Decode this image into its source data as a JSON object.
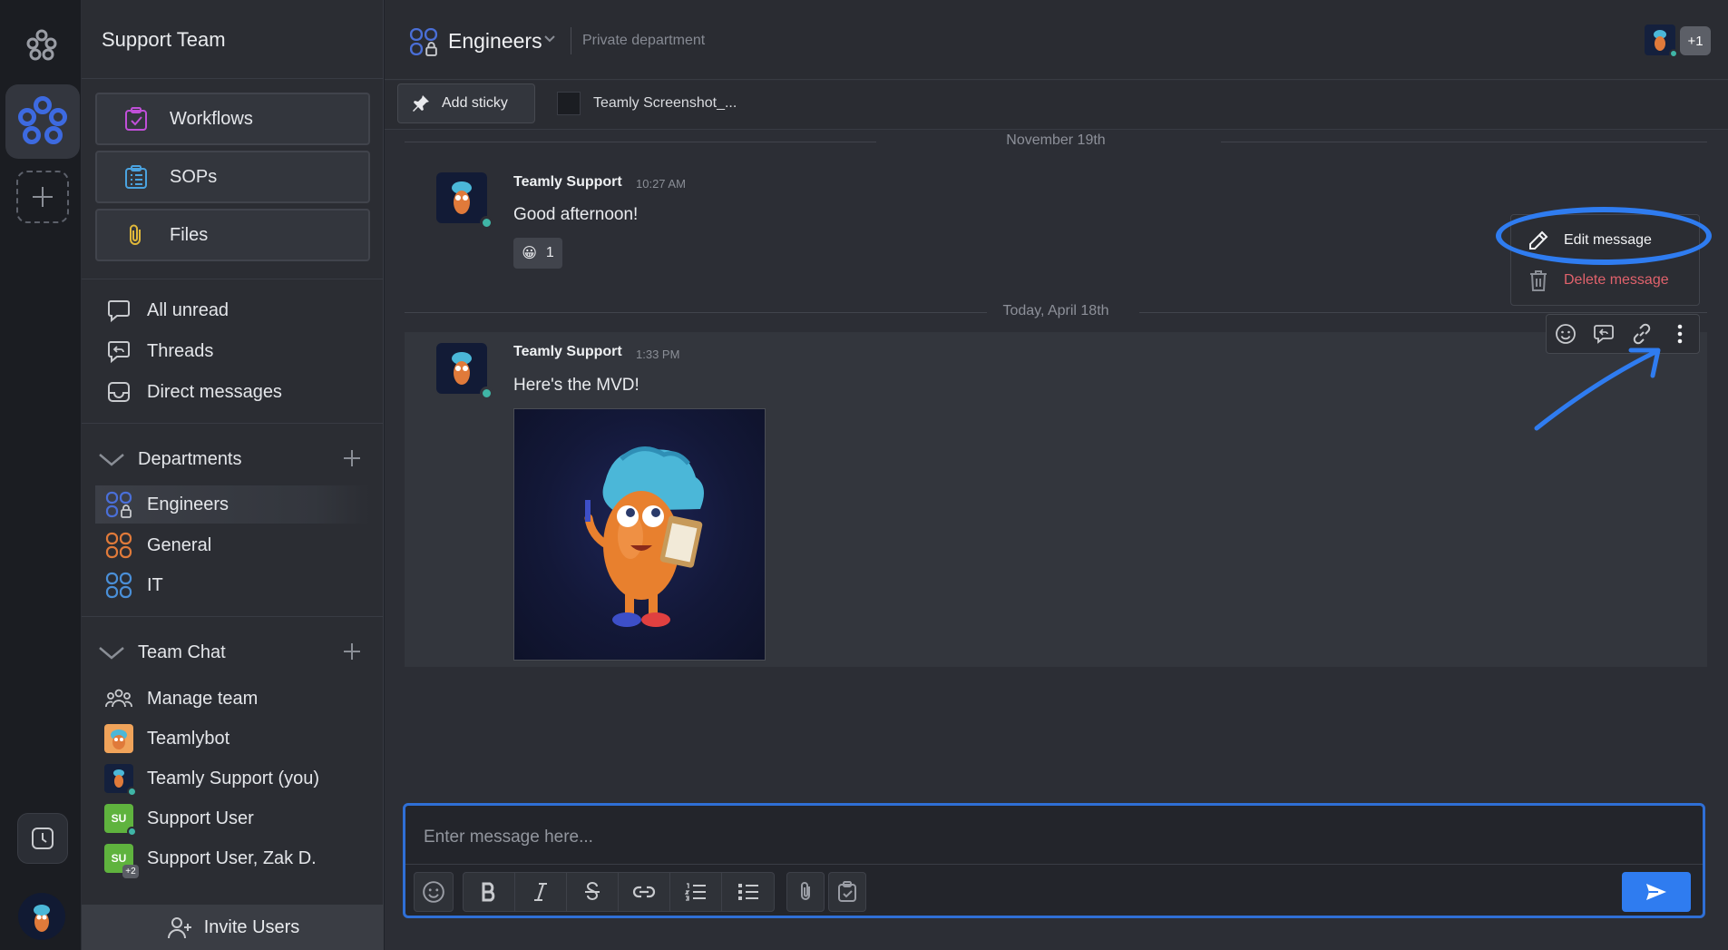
{
  "sidebar": {
    "team_name": "Support Team",
    "quick": [
      {
        "label": "Workflows",
        "icon": "workflows-icon"
      },
      {
        "label": "SOPs",
        "icon": "sops-icon"
      },
      {
        "label": "Files",
        "icon": "paperclip-icon"
      }
    ],
    "inbox": [
      {
        "label": "All unread",
        "icon": "chat-bubble-icon"
      },
      {
        "label": "Threads",
        "icon": "threads-icon"
      },
      {
        "label": "Direct messages",
        "icon": "inbox-tray-icon"
      }
    ],
    "departments": {
      "title": "Departments",
      "items": [
        {
          "label": "Engineers",
          "color": "#4a6fd8"
        },
        {
          "label": "General",
          "color": "#e07a3a"
        },
        {
          "label": "IT",
          "color": "#4a8fd8"
        }
      ]
    },
    "team_chat": {
      "title": "Team Chat",
      "items": [
        {
          "label": "Manage team"
        },
        {
          "label": "Teamlybot"
        },
        {
          "label": "Teamly Support (you)"
        },
        {
          "label": "Support User",
          "initials": "SU"
        },
        {
          "label": "Support User, Zak D.",
          "initials": "SU",
          "extra": "+2"
        }
      ]
    },
    "invite_label": "Invite Users"
  },
  "channel": {
    "name": "Engineers",
    "description": "Private department",
    "member_extra": "+1"
  },
  "toolbar": {
    "add_sticky": "Add sticky",
    "file_name": "Teamly Screenshot_..."
  },
  "messages": {
    "date1": "November 19th",
    "date2": "Today, April 18th",
    "m1": {
      "author": "Teamly Support",
      "time": "10:27 AM",
      "body": "Good afternoon!",
      "reaction_emoji": "😀",
      "reaction_count": "1"
    },
    "m2": {
      "author": "Teamly Support",
      "time": "1:33 PM",
      "body": "Here's the MVD!"
    }
  },
  "context_menu": {
    "edit": "Edit message",
    "delete": "Delete message"
  },
  "composer": {
    "placeholder": "Enter message here..."
  },
  "colors": {
    "accent": "#2f7cf0",
    "danger": "#e0626c",
    "online": "#3fb5a6"
  }
}
